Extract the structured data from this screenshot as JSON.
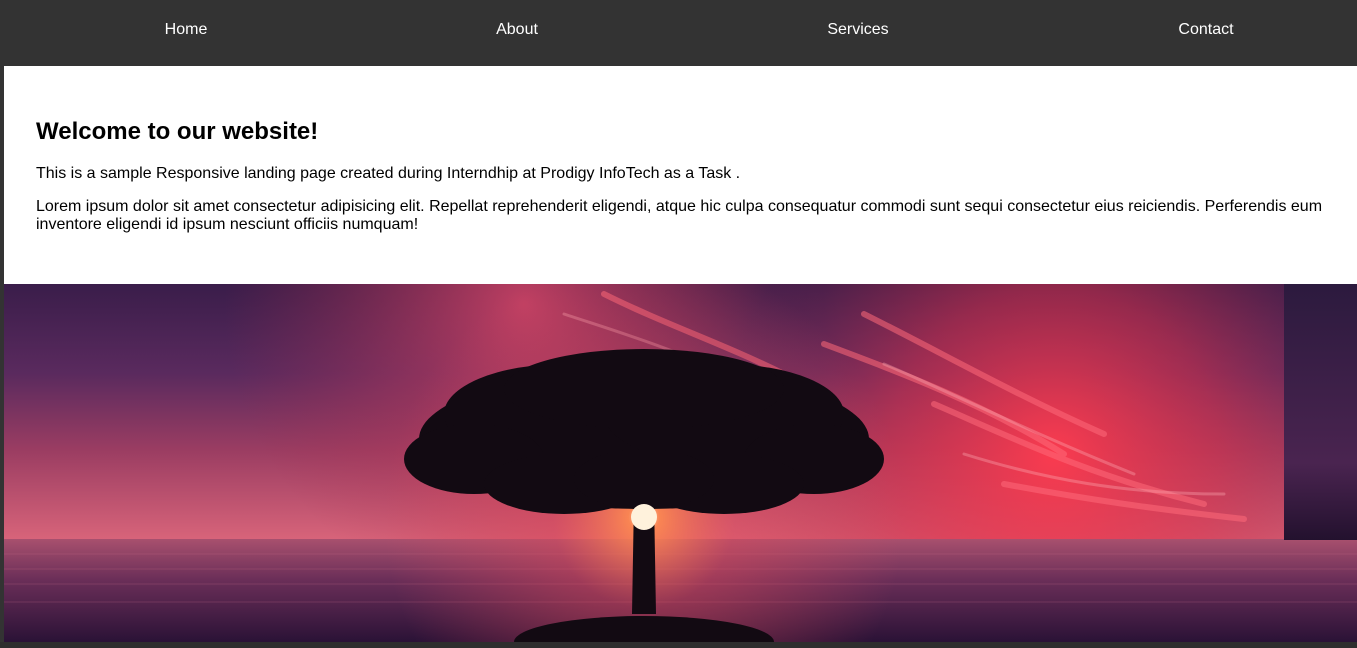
{
  "nav": {
    "home": "Home",
    "about": "About",
    "services": "Services",
    "contact": "Contact"
  },
  "main": {
    "title": "Welcome to our website!",
    "intro": "This is a sample Responsive landing page created during Interndhip at Prodigy InfoTech as a Task .",
    "lorem": "Lorem ipsum dolor sit amet consectetur adipisicing elit. Repellat reprehenderit eligendi, atque hic culpa consequatur commodi sunt sequi consectetur eius reiciendis. Perferendis eum inventore eligendi id ipsum nesciunt officiis numquam!"
  },
  "hero": {
    "image": "sunset-tree-image"
  },
  "colors": {
    "nav_background": "#333333",
    "content_background": "#ffffff",
    "text": "#000000",
    "nav_text": "#ffffff"
  }
}
